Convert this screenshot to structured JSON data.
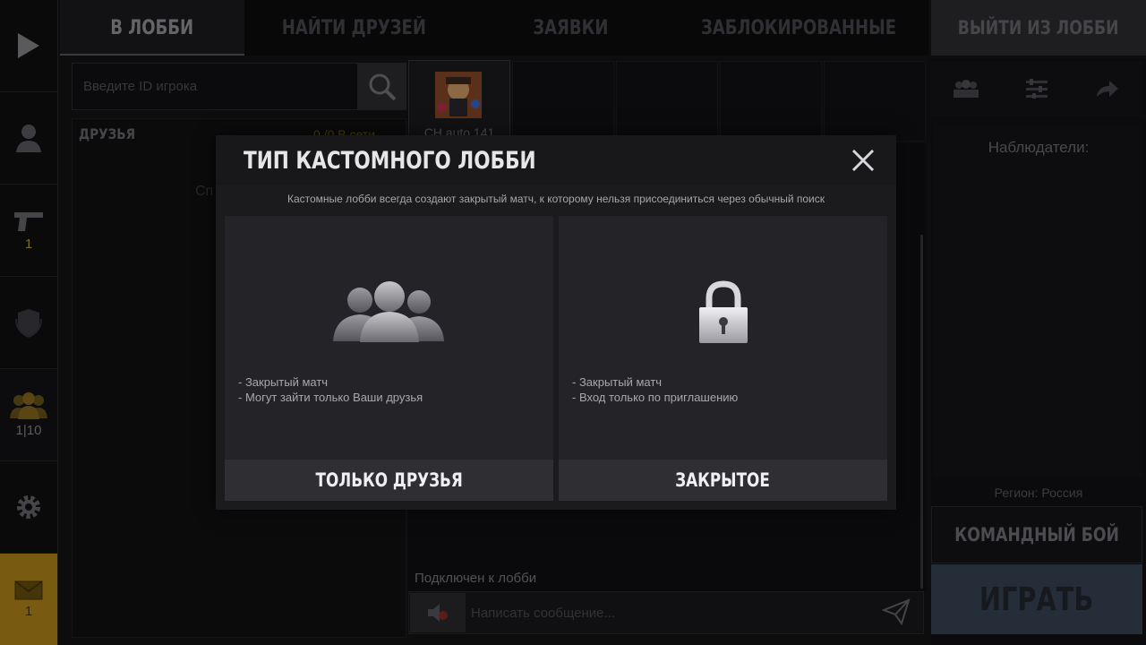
{
  "sidebar": {
    "items": [
      {
        "name": "play",
        "icon": "play-icon"
      },
      {
        "name": "profile",
        "icon": "person-icon"
      },
      {
        "name": "weapons",
        "icon": "pistol-icon",
        "count": "1"
      },
      {
        "name": "clan",
        "icon": "shield-icon"
      },
      {
        "name": "lobby",
        "icon": "group-icon",
        "count": "1|10"
      },
      {
        "name": "settings",
        "icon": "gear-icon"
      },
      {
        "name": "mail",
        "icon": "mail-icon",
        "count": "1"
      }
    ]
  },
  "tabs": [
    {
      "label": "В ЛОББИ",
      "active": true
    },
    {
      "label": "НАЙТИ ДРУЗЕЙ",
      "active": false
    },
    {
      "label": "ЗАЯВКИ",
      "active": false
    },
    {
      "label": "ЗАБЛОКИРОВАННЫЕ",
      "active": false
    }
  ],
  "exit_button": "ВЫЙТИ ИЗ ЛОББИ",
  "search": {
    "placeholder": "Введите ID игрока"
  },
  "friends": {
    "title": "ДРУЗЬЯ",
    "count": "0 /0 В сети",
    "hint": "Сп"
  },
  "player": {
    "name": "CH auto 141"
  },
  "chat": {
    "status": "Подключен к лобби",
    "placeholder": "Написать сообщение..."
  },
  "right_panel": {
    "observers_label": "Наблюдатели:",
    "region": "Регион: Россия",
    "mode_button": "КОМАНДНЫЙ БОЙ",
    "play_button": "ИГРАТЬ"
  },
  "modal": {
    "title": "ТИП КАСТОМНОГО ЛОББИ",
    "subtitle": "Кастомные лобби всегда создают закрытый матч, к которому нельзя присоединиться через обычный поиск",
    "options": [
      {
        "icon": "friends-group-icon",
        "desc": "- Закрытый матч\n- Могут зайти только Ваши друзья",
        "button": "ТОЛЬКО ДРУЗЬЯ"
      },
      {
        "icon": "padlock-icon",
        "desc": "- Закрытый матч\n- Вход только по приглашению",
        "button": "ЗАКРЫТОЕ"
      }
    ]
  },
  "colors": {
    "accent_gold": "#c9a12a",
    "play_button": "#3a4656",
    "mail_highlight": "#b88a1a"
  }
}
